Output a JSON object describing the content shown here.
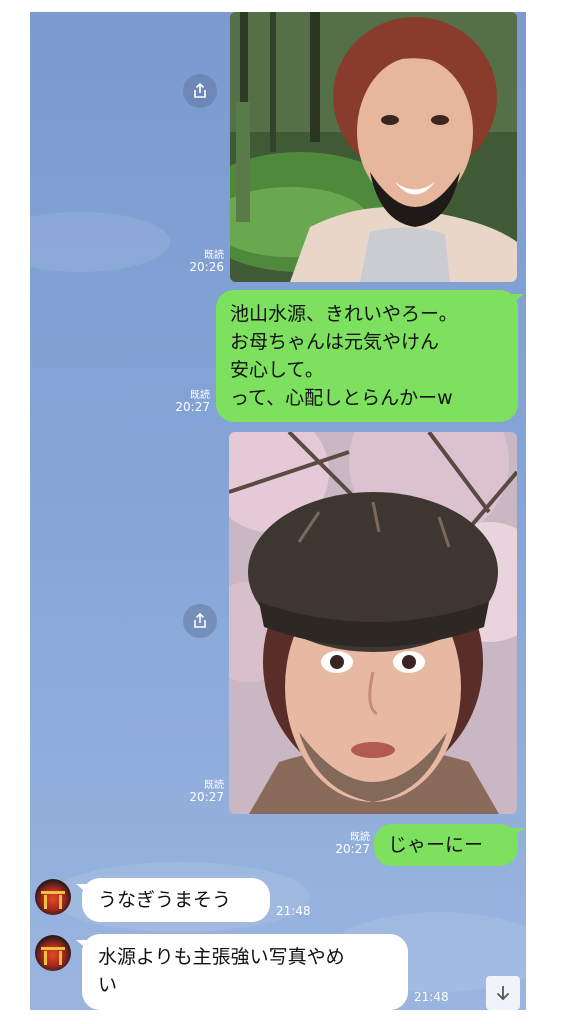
{
  "messages": [
    {
      "type": "image",
      "direction": "outgoing",
      "read_label": "既読",
      "time": "20:26",
      "image_desc": "person-forest-pond"
    },
    {
      "type": "text",
      "direction": "outgoing",
      "read_label": "既読",
      "time": "20:27",
      "lines": [
        "池山水源、きれいやろー。",
        "お母ちゃんは元気やけん",
        "安心して。",
        "って、心配しとらんかーw"
      ]
    },
    {
      "type": "image",
      "direction": "outgoing",
      "read_label": "既読",
      "time": "20:27",
      "image_desc": "person-cap-cherry-blossom"
    },
    {
      "type": "text",
      "direction": "outgoing",
      "read_label": "既読",
      "time": "20:27",
      "lines": [
        "じゃーにー"
      ]
    },
    {
      "type": "text",
      "direction": "incoming",
      "time": "21:48",
      "lines": [
        "うなぎうまそう"
      ]
    },
    {
      "type": "text",
      "direction": "incoming",
      "time": "21:48",
      "lines": [
        "水源よりも主張強い写真やめ",
        "い"
      ]
    }
  ],
  "icons": {
    "share": "share-icon",
    "scroll_down": "arrow-down-icon"
  },
  "colors": {
    "chat_background": "#7b9bd0",
    "outgoing_bubble": "#7de05e",
    "incoming_bubble": "#ffffff"
  }
}
